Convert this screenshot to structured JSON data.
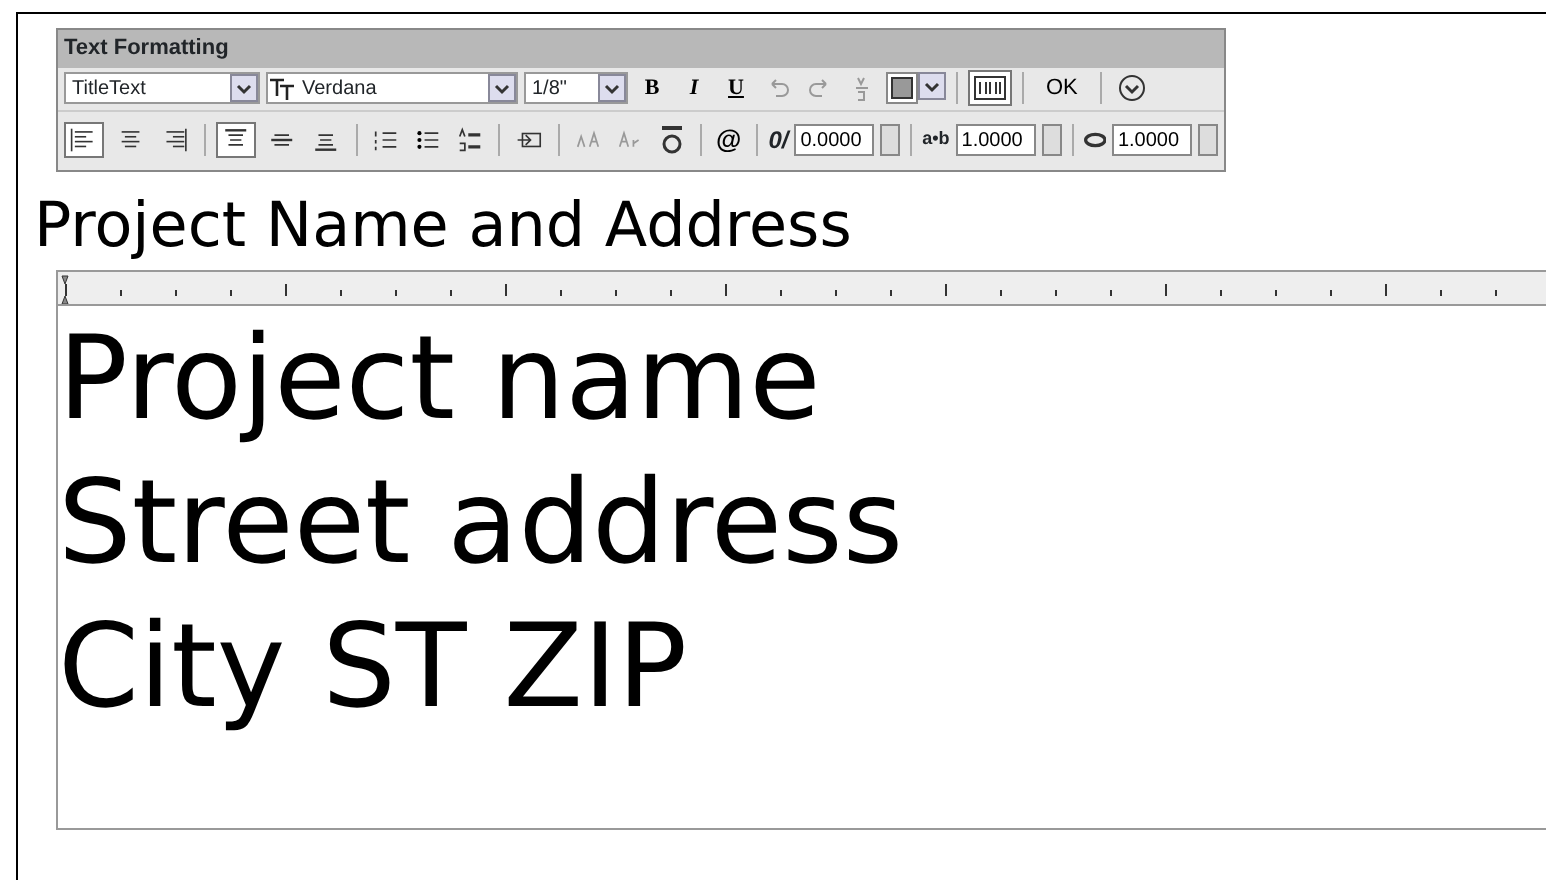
{
  "toolbar": {
    "title": "Text Formatting",
    "style": {
      "value": "TitleText"
    },
    "font": {
      "value": "Verdana"
    },
    "height": {
      "value": "1/8\""
    },
    "format_buttons": [
      {
        "label": "B",
        "kind": "bold"
      },
      {
        "label": "I",
        "kind": "italic"
      },
      {
        "label": "U",
        "kind": "underline"
      }
    ],
    "ok": {
      "label": "OK"
    },
    "ruler_toggle": {
      "selected": true
    },
    "justify": [
      {
        "kind": "left",
        "selected": true
      },
      {
        "kind": "center",
        "selected": false
      },
      {
        "kind": "right",
        "selected": false
      }
    ],
    "vertical": [
      {
        "kind": "top",
        "selected": true
      },
      {
        "kind": "middle",
        "selected": false
      },
      {
        "kind": "bottom",
        "selected": false
      }
    ],
    "symbol": {
      "label": "@"
    },
    "oblique": {
      "label": "0/",
      "value": "0.0000"
    },
    "tracking": {
      "label": "a•b",
      "value": "1.0000"
    },
    "width_factor": {
      "value": "1.0000"
    }
  },
  "heading": "Project Name and Address",
  "lines": [
    "Project name",
    "Street address",
    "City ST ZIP"
  ]
}
